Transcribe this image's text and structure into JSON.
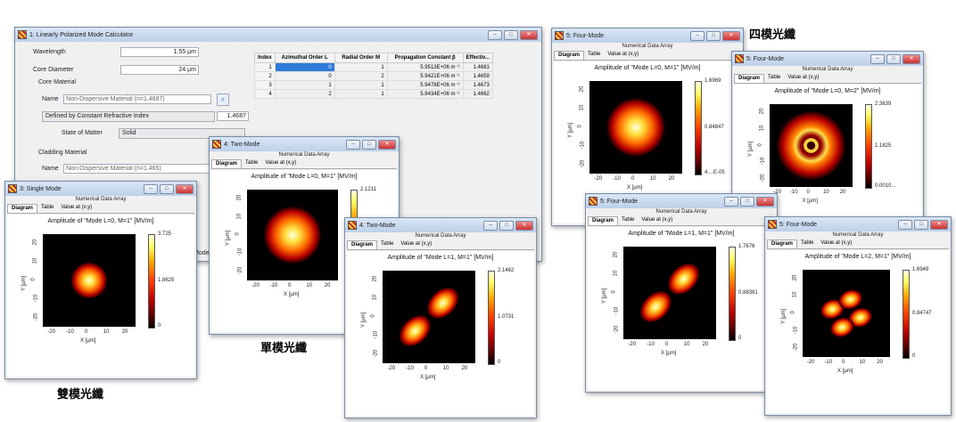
{
  "labels": {
    "four_mode": "四模光纖",
    "single_mode": "單模光纖",
    "two_mode": "雙模光纖"
  },
  "calculator": {
    "title": "1: Linearly Polarized Mode Calculator",
    "wavelength_label": "Wavelength",
    "wavelength_value": "1.55 µm",
    "core_diameter_label": "Core Diameter",
    "core_diameter_value": "24 µm",
    "core_material_label": "Core Material",
    "name_label": "Name",
    "core_name_value": "Non-Dispersive Material (n=1.4687)",
    "defined_by": "Defined by Constant Refractive Index",
    "refractive_index": "1.4687",
    "state_label": "State of Matter",
    "state_value": "Solid",
    "cladding_label": "Cladding Material",
    "cladding_name_value": "Non-Dispersive Material (n=1.465)",
    "partial_text": "Mode",
    "table": {
      "headers": [
        "Index",
        "Azimuthal Order L",
        "Radial Order M",
        "Propagation Constant β",
        "Effectiv..."
      ],
      "rows": [
        [
          "1",
          "0",
          "1",
          "5.9513E+06 m⁻¹",
          "1.4681"
        ],
        [
          "2",
          "0",
          "2",
          "5.9421E+06 m⁻¹",
          "1.4659"
        ],
        [
          "3",
          "1",
          "1",
          "5.9478E+06 m⁻¹",
          "1.4673"
        ],
        [
          "4",
          "2",
          "1",
          "5.9434E+06 m⁻¹",
          "1.4662"
        ]
      ]
    }
  },
  "common": {
    "numerical_data_array": "Numerical Data Array",
    "tab_diagram": "Diagram",
    "tab_table": "Table",
    "tab_value": "Value at (x,y)",
    "x_label": "X [µm]",
    "y_label": "Y [µm]"
  },
  "windows": [
    {
      "title": "3: Single Mode",
      "plot_title": "Amplitude of \"Mode L=0, M=1\"  [MV/m]",
      "cb_max": "3.725",
      "cb_mid": "1.8625",
      "cb_min": "0",
      "xticks": [
        "-20",
        "-10",
        "0",
        "10",
        "20"
      ],
      "yticks": [
        "20",
        "10",
        "0",
        "-10",
        "-20"
      ]
    },
    {
      "title": "4: Two-Mode",
      "plot_title": "Amplitude of \"Mode L=0, M=1\"  [MV/m]",
      "cb_max": "2.1211",
      "cb_mid": "",
      "cb_min": "",
      "xticks": [
        "-20",
        "-10",
        "0",
        "10",
        "20"
      ],
      "yticks": [
        "20",
        "10",
        "0",
        "-10",
        "-20"
      ]
    },
    {
      "title": "4: Two-Mode",
      "plot_title": "Amplitude of \"Mode L=1, M=1\"  [MV/m]",
      "cb_max": "2.1462",
      "cb_mid": "1.0731",
      "cb_min": "0",
      "xticks": [
        "-20",
        "-10",
        "0",
        "10",
        "20"
      ],
      "yticks": [
        "20",
        "10",
        "0",
        "-10",
        "-20"
      ]
    },
    {
      "title": "5: Four-Mode",
      "plot_title": "Amplitude of \"Mode L=0, M=1\"  [MV/m]",
      "cb_max": "1.6969",
      "cb_mid": "0.84847",
      "cb_min": "4....E-05",
      "xticks": [
        "-20",
        "-10",
        "0",
        "10",
        "20"
      ],
      "yticks": [
        "20",
        "10",
        "0",
        "-10",
        "-20"
      ]
    },
    {
      "title": "5: Four-Mode",
      "plot_title": "Amplitude of \"Mode L=0, M=2\"  [MV/m]",
      "cb_max": "2.3639",
      "cb_mid": "1.1825",
      "cb_min": "0.0010...",
      "xticks": [
        "-20",
        "-10",
        "0",
        "10",
        "20"
      ],
      "yticks": [
        "20",
        "10",
        "0",
        "-10",
        "-20"
      ]
    },
    {
      "title": "5: Four-Mode",
      "plot_title": "Amplitude of \"Mode L=1, M=1\"  [MV/m]",
      "cb_max": "1.7676",
      "cb_mid": "0.88381",
      "cb_min": "0",
      "xticks": [
        "-20",
        "-10",
        "0",
        "10",
        "20"
      ],
      "yticks": [
        "20",
        "10",
        "0",
        "-10",
        "-20"
      ]
    },
    {
      "title": "5: Four-Mode",
      "plot_title": "Amplitude of \"Mode L=2, M=1\"  [MV/m]",
      "cb_max": "1.6949",
      "cb_mid": "0.84747",
      "cb_min": "0",
      "xticks": [
        "-20",
        "-10",
        "0",
        "10",
        "20"
      ],
      "yticks": [
        "20",
        "10",
        "0",
        "-10",
        "-20"
      ]
    }
  ]
}
